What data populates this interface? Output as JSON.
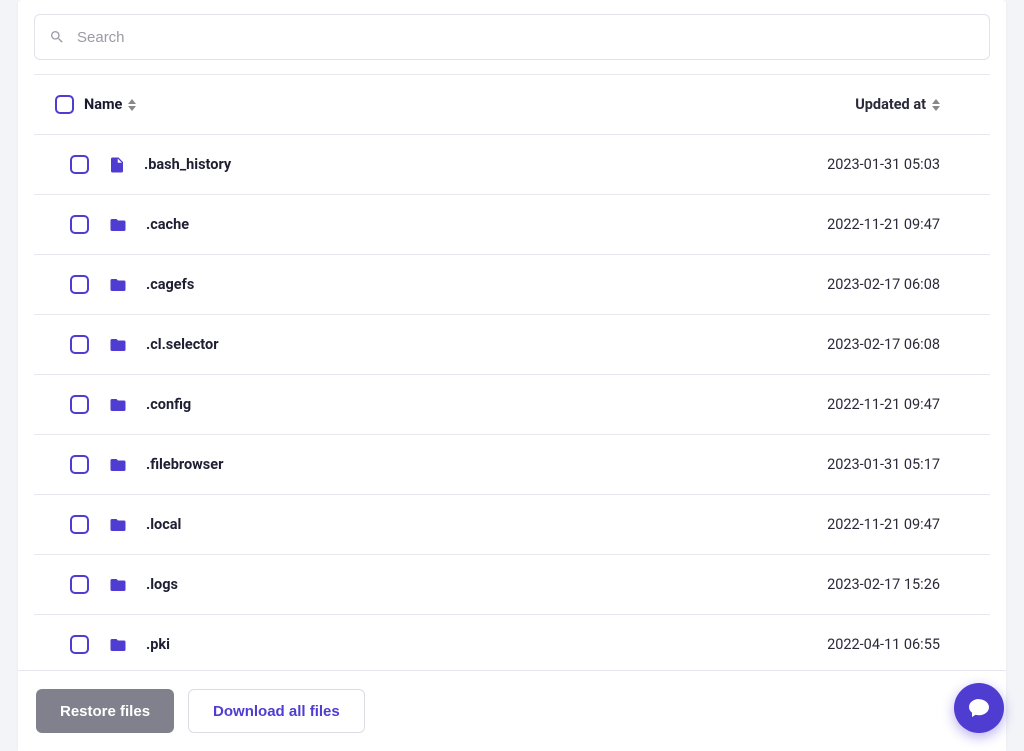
{
  "search": {
    "placeholder": "Search"
  },
  "columns": {
    "name": "Name",
    "updated_at": "Updated at"
  },
  "items": [
    {
      "type": "file",
      "name": ".bash_history",
      "updated_at": "2023-01-31 05:03"
    },
    {
      "type": "folder",
      "name": ".cache",
      "updated_at": "2022-11-21 09:47"
    },
    {
      "type": "folder",
      "name": ".cagefs",
      "updated_at": "2023-02-17 06:08"
    },
    {
      "type": "folder",
      "name": ".cl.selector",
      "updated_at": "2023-02-17 06:08"
    },
    {
      "type": "folder",
      "name": ".config",
      "updated_at": "2022-11-21 09:47"
    },
    {
      "type": "folder",
      "name": ".filebrowser",
      "updated_at": "2023-01-31 05:17"
    },
    {
      "type": "folder",
      "name": ".local",
      "updated_at": "2022-11-21 09:47"
    },
    {
      "type": "folder",
      "name": ".logs",
      "updated_at": "2023-02-17 15:26"
    },
    {
      "type": "folder",
      "name": ".pki",
      "updated_at": "2022-04-11 06:55"
    }
  ],
  "footer": {
    "restore": "Restore files",
    "download": "Download all files"
  },
  "colors": {
    "accent": "#4f3dd1",
    "muted": "#80818d"
  }
}
